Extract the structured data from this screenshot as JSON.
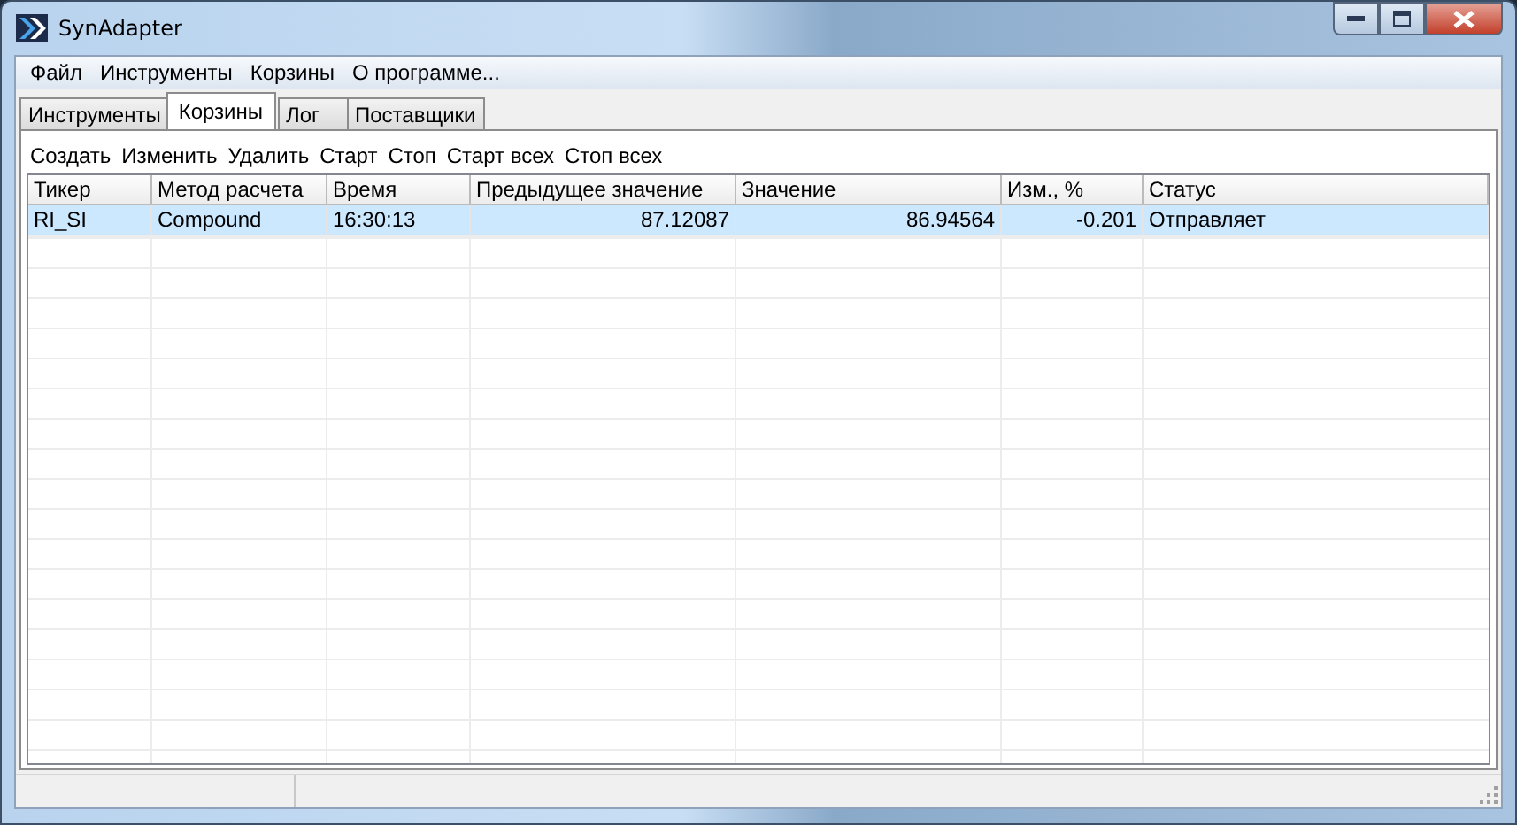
{
  "window": {
    "title": "SynAdapter"
  },
  "menu": [
    "Файл",
    "Инструменты",
    "Корзины",
    "О программе..."
  ],
  "tabs": [
    {
      "label": "Инструменты",
      "selected": false
    },
    {
      "label": "Корзины",
      "selected": true
    },
    {
      "label": "Лог",
      "selected": false
    },
    {
      "label": "Поставщики",
      "selected": false
    }
  ],
  "toolbar": [
    "Создать",
    "Изменить",
    "Удалить",
    "Старт",
    "Стоп",
    "Старт всех",
    "Стоп всех"
  ],
  "table": {
    "columns": [
      {
        "label": "Тикер",
        "kind": "text"
      },
      {
        "label": "Метод расчета",
        "kind": "text"
      },
      {
        "label": "Время",
        "kind": "text"
      },
      {
        "label": "Предыдущее значение",
        "kind": "number"
      },
      {
        "label": "Значение",
        "kind": "number"
      },
      {
        "label": "Изм., %",
        "kind": "number"
      },
      {
        "label": "Статус",
        "kind": "text"
      }
    ],
    "rows": [
      {
        "selected": true,
        "cells": [
          "RI_SI",
          "Compound",
          "16:30:13",
          "87.12087",
          "86.94564",
          "-0.201",
          "Отправляет"
        ]
      }
    ]
  }
}
